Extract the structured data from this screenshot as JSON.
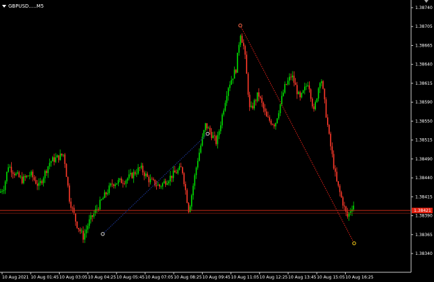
{
  "symbol": "GBPUSD.....M5",
  "colors": {
    "background": "#000000",
    "bull": "#00e000",
    "bear": "#ff3a2a",
    "price_line": "#d22b16",
    "price_tag": "#e02010",
    "axis": "#cccccc",
    "trend_red": "#e8231b",
    "trend_blue": "#1f3aa0"
  },
  "icons": {
    "dropdown": "dropdown-arrow-icon",
    "scroll": "scroll-position-icon"
  },
  "chart_data": {
    "type": "candlestick",
    "y_ticks": [
      "1.38740",
      "1.38705",
      "1.38665",
      "1.38640",
      "1.38615",
      "1.38590",
      "1.38550",
      "1.38515",
      "1.38490",
      "1.38440",
      "1.38415",
      "1.38390",
      "1.38365",
      "1.38340"
    ],
    "x_ticks": [
      "10 Aug 2021",
      "10 Aug 01:45",
      "10 Aug 03:05",
      "10 Aug 04:25",
      "10 Aug 05:45",
      "10 Aug 07:05",
      "10 Aug 08:25",
      "10 Aug 09:45",
      "10 Aug 11:05",
      "10 Aug 12:25",
      "10 Aug 13:45",
      "10 Aug 15:05",
      "10 Aug 16:25"
    ],
    "current_price": "1.38421",
    "ylim": [
      1.3832,
      1.3875
    ],
    "grid": false,
    "anchors": [
      [
        0,
        1.3845
      ],
      [
        6,
        1.3846
      ],
      [
        12,
        1.38494
      ],
      [
        22,
        1.3848
      ],
      [
        32,
        1.3847
      ],
      [
        44,
        1.3848
      ],
      [
        56,
        1.3846
      ],
      [
        72,
        1.385
      ],
      [
        92,
        1.38512
      ],
      [
        100,
        1.3844
      ],
      [
        110,
        1.384
      ],
      [
        120,
        1.38378
      ],
      [
        128,
        1.38402
      ],
      [
        148,
        1.3844
      ],
      [
        162,
        1.38465
      ],
      [
        180,
        1.3847
      ],
      [
        190,
        1.38478
      ],
      [
        202,
        1.3849
      ],
      [
        215,
        1.3847
      ],
      [
        230,
        1.3846
      ],
      [
        250,
        1.3848
      ],
      [
        262,
        1.3849
      ],
      [
        272,
        1.3842
      ],
      [
        284,
        1.385
      ],
      [
        296,
        1.3856
      ],
      [
        312,
        1.3853
      ],
      [
        328,
        1.3862
      ],
      [
        340,
        1.3865
      ],
      [
        346,
        1.3871
      ],
      [
        352,
        1.3868
      ],
      [
        360,
        1.3858
      ],
      [
        372,
        1.3861
      ],
      [
        384,
        1.3857
      ],
      [
        396,
        1.3856
      ],
      [
        410,
        1.3862
      ],
      [
        420,
        1.3864
      ],
      [
        432,
        1.386
      ],
      [
        444,
        1.3863
      ],
      [
        452,
        1.3858
      ],
      [
        462,
        1.3864
      ],
      [
        474,
        1.3854
      ],
      [
        484,
        1.3847
      ],
      [
        492,
        1.3844
      ],
      [
        500,
        1.3841
      ],
      [
        508,
        1.3843
      ]
    ],
    "trendlines": [
      {
        "color": "red",
        "style": "dotted",
        "x1": 346,
        "y1": 1.3872,
        "x2": 510,
        "y2": 1.38368
      },
      {
        "color": "blue",
        "style": "dotted",
        "x1": 148,
        "y1": 1.38383,
        "x2": 299,
        "y2": 1.38545
      }
    ],
    "markers": [
      {
        "x": 346,
        "y": 1.3872,
        "color": "#ff6a4a"
      },
      {
        "x": 510,
        "y": 1.38368,
        "color": "#ffd21a"
      },
      {
        "x": 299,
        "y": 1.38545,
        "color": "#dddddd"
      },
      {
        "x": 148,
        "y": 1.38383,
        "color": "#dddddd"
      }
    ]
  }
}
